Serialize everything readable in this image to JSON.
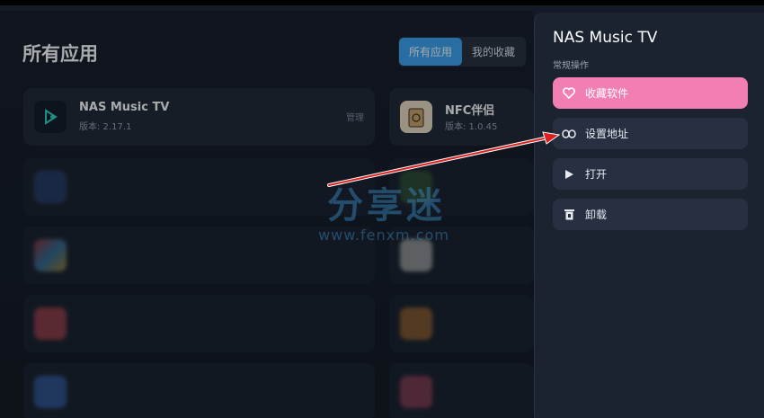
{
  "header": {
    "title": "所有应用",
    "tabs": [
      {
        "label": "所有应用",
        "active": true
      },
      {
        "label": "我的收藏",
        "active": false
      }
    ]
  },
  "apps": [
    {
      "name": "NAS Music TV",
      "version": "版本: 2.17.1",
      "manage": "管理",
      "icon": "nas-music-icon"
    },
    {
      "name": "NFC伴侣",
      "version": "版本: 1.0.45",
      "icon": "nfc-companion-icon"
    }
  ],
  "panel": {
    "title": "NAS Music TV",
    "subtitle": "常规操作",
    "actions": [
      {
        "label": "收藏软件",
        "icon": "heart-icon"
      },
      {
        "label": "设置地址",
        "icon": "link-icon"
      },
      {
        "label": "打开",
        "icon": "play-icon"
      },
      {
        "label": "卸载",
        "icon": "trash-icon"
      }
    ]
  },
  "watermark": {
    "text": "分享迷",
    "url": "www.fenxm.com"
  },
  "colors": {
    "accent": "#3aa4f2",
    "favorite": "#f27fb4",
    "annotation_arrow": "#e02020"
  }
}
